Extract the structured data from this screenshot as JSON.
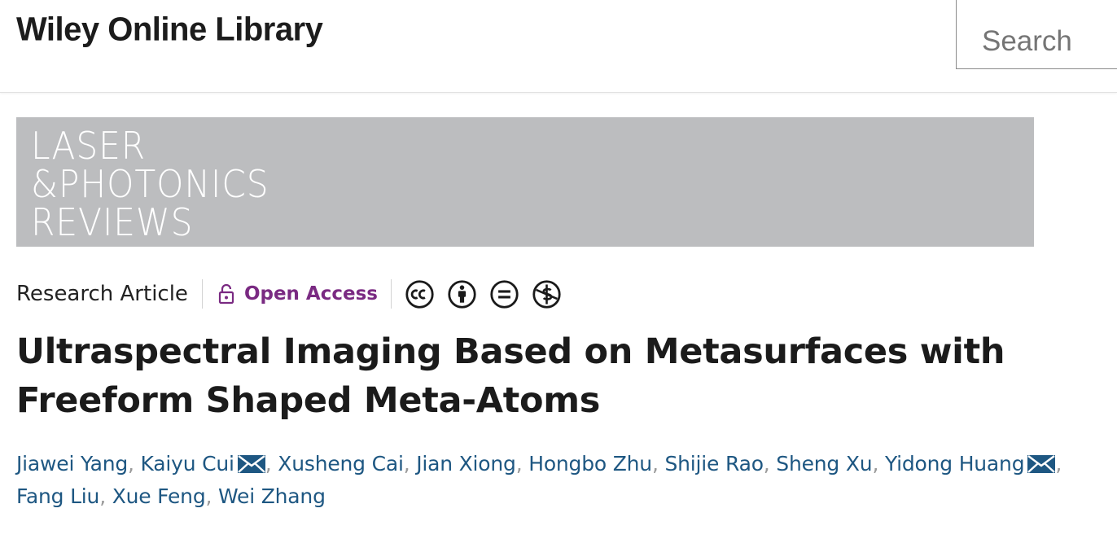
{
  "header": {
    "brand": "Wiley Online Library",
    "search_placeholder": "Search"
  },
  "journal_banner": {
    "lines": [
      "LASER",
      "&PHOTONICS",
      "REVIEWS"
    ]
  },
  "article_meta": {
    "type": "Research Article",
    "access": "Open Access",
    "license_icons": [
      "cc-icon",
      "by-icon",
      "nd-icon",
      "nc-icon"
    ]
  },
  "article": {
    "title": "Ultraspectral Imaging Based on Metasurfaces with Freeform Shaped Meta-Atoms"
  },
  "authors": [
    {
      "name": "Jiawei Yang",
      "corresponding": false
    },
    {
      "name": "Kaiyu Cui",
      "corresponding": true
    },
    {
      "name": "Xusheng Cai",
      "corresponding": false
    },
    {
      "name": "Jian Xiong",
      "corresponding": false
    },
    {
      "name": "Hongbo Zhu",
      "corresponding": false
    },
    {
      "name": "Shijie Rao",
      "corresponding": false
    },
    {
      "name": "Sheng Xu",
      "corresponding": false
    },
    {
      "name": "Yidong Huang",
      "corresponding": true
    },
    {
      "name": "Fang Liu",
      "corresponding": false
    },
    {
      "name": "Xue Feng",
      "corresponding": false
    },
    {
      "name": "Wei Zhang",
      "corresponding": false
    }
  ],
  "colors": {
    "link": "#1e5782",
    "open_access": "#7a2a82",
    "banner": "#bcbdbf"
  }
}
